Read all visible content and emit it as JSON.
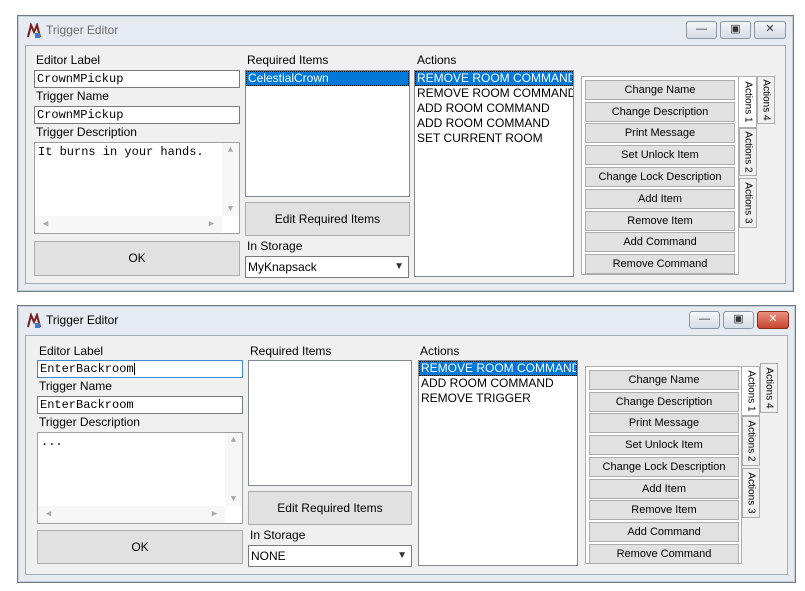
{
  "windows": [
    {
      "title": "Trigger Editor",
      "editor_label_caption": "Editor Label",
      "editor_label_value": "CrownMPickup",
      "trigger_name_caption": "Trigger Name",
      "trigger_name_value": "CrownMPickup",
      "trigger_description_caption": "Trigger Description",
      "trigger_description_value": "It burns in your hands.",
      "ok_label": "OK",
      "required_items_caption": "Required Items",
      "required_items": [
        "CelestialCrown"
      ],
      "edit_required_items_label": "Edit Required Items",
      "in_storage_caption": "In Storage",
      "in_storage_value": "MyKnapsack",
      "actions_caption": "Actions",
      "actions": [
        "REMOVE ROOM COMMAND",
        "REMOVE ROOM COMMAND",
        "ADD ROOM COMMAND",
        "ADD ROOM COMMAND",
        "SET CURRENT ROOM"
      ],
      "action_buttons": [
        "Change Name",
        "Change Description",
        "Print Message",
        "Set Unlock Item",
        "Change Lock Description",
        "Add Item",
        "Remove Item",
        "Add Command",
        "Remove Command"
      ],
      "tabs": [
        "Actions 4",
        "Actions 1",
        "Actions 2",
        "Actions 3"
      ]
    },
    {
      "title": "Trigger Editor",
      "editor_label_caption": "Editor Label",
      "editor_label_value": "EnterBackroom",
      "trigger_name_caption": "Trigger Name",
      "trigger_name_value": "EnterBackroom",
      "trigger_description_caption": "Trigger Description",
      "trigger_description_value": "...",
      "ok_label": "OK",
      "required_items_caption": "Required Items",
      "required_items": [],
      "edit_required_items_label": "Edit Required Items",
      "in_storage_caption": "In Storage",
      "in_storage_value": "NONE",
      "actions_caption": "Actions",
      "actions": [
        "REMOVE ROOM COMMAND",
        "ADD ROOM COMMAND",
        "REMOVE TRIGGER"
      ],
      "action_buttons": [
        "Change Name",
        "Change Description",
        "Print Message",
        "Set Unlock Item",
        "Change Lock Description",
        "Add Item",
        "Remove Item",
        "Add Command",
        "Remove Command"
      ],
      "tabs": [
        "Actions 4",
        "Actions 1",
        "Actions 2",
        "Actions 3"
      ]
    }
  ],
  "controls": {
    "minimize_glyph": "—",
    "maximize_glyph": "▣",
    "close_glyph": "✕"
  },
  "colors": {
    "selection": "#0078d7",
    "close_active": "#c6452f"
  }
}
